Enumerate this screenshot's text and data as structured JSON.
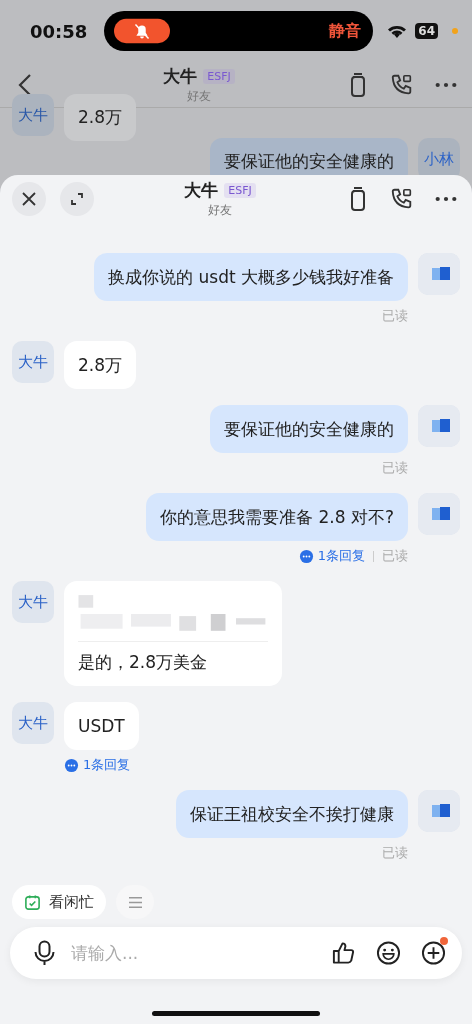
{
  "status_bar": {
    "time": "00:58",
    "island": {
      "muted": true,
      "label": "静音"
    },
    "battery": "64"
  },
  "background_chat": {
    "header": {
      "title": "大牛",
      "badge": "ESFJ",
      "subtitle": "好友"
    },
    "messages": [
      {
        "kind": "received",
        "avatar": "大牛",
        "text": "2.8万"
      },
      {
        "kind": "sent",
        "avatar": "小林",
        "text": "要保证他的安全健康的"
      }
    ]
  },
  "sheet": {
    "header": {
      "title": "大牛",
      "badge": "ESFJ",
      "subtitle": "好友"
    },
    "messages": [
      {
        "kind": "sent",
        "text": "换成你说的 usdt 大概多少钱我好准备",
        "status": "已读"
      },
      {
        "kind": "received",
        "avatar": "大牛",
        "text": "2.8万"
      },
      {
        "kind": "sent",
        "text": "要保证他的安全健康的",
        "status": "已读"
      },
      {
        "kind": "sent",
        "text": "你的意思我需要准备 2.8 对不?",
        "replies": "1条回复",
        "status": "已读"
      },
      {
        "kind": "received",
        "avatar": "大牛",
        "text": "是的，2.8万美金",
        "quoted": true
      },
      {
        "kind": "received",
        "avatar": "大牛",
        "text": "USDT",
        "replies": "1条回复"
      },
      {
        "kind": "sent",
        "text": "保证王祖校安全不挨打健康",
        "status": "已读"
      }
    ],
    "quick_actions": [
      {
        "kind": "chip",
        "label": "看闲忙"
      },
      {
        "kind": "menu"
      }
    ],
    "input": {
      "placeholder": "请输入...",
      "plus_badge": true
    }
  }
}
